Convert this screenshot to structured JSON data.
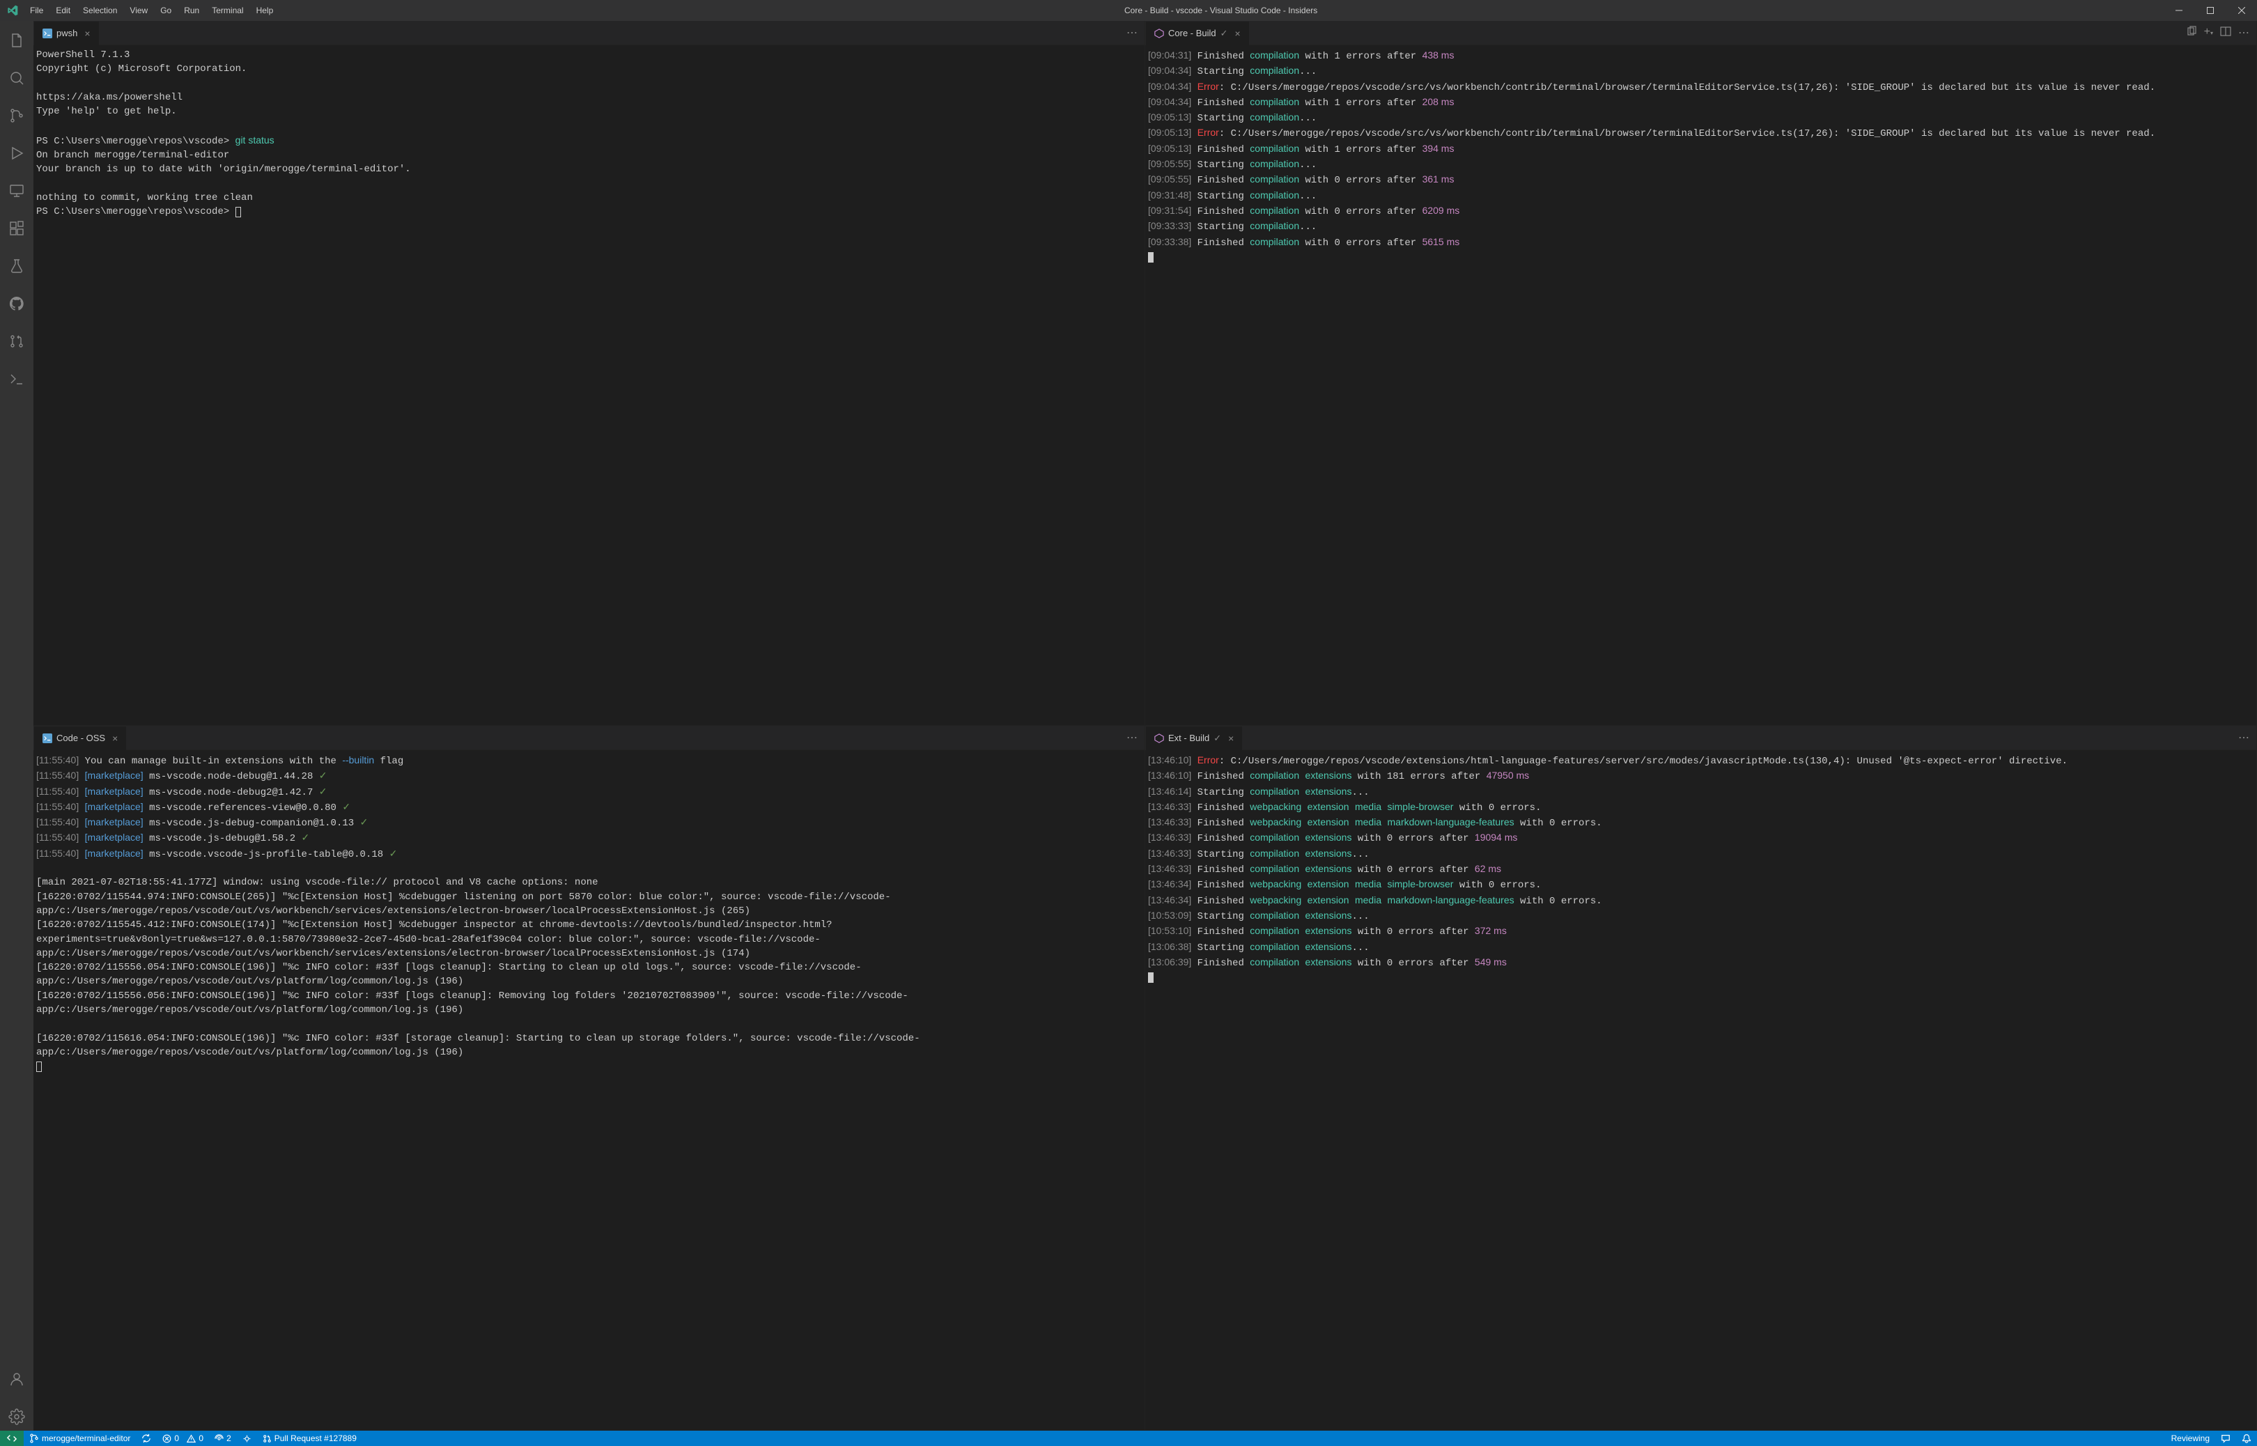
{
  "menubar": [
    "File",
    "Edit",
    "Selection",
    "View",
    "Go",
    "Run",
    "Terminal",
    "Help"
  ],
  "window_title": "Core - Build - vscode - Visual Studio Code - Insiders",
  "tabs": {
    "top_left": {
      "label": "pwsh"
    },
    "top_right": {
      "label": "Core - Build"
    },
    "bottom_left": {
      "label": "Code - OSS"
    },
    "bottom_right": {
      "label": "Ext - Build"
    }
  },
  "pwsh": {
    "l1": "PowerShell 7.1.3",
    "l2": "Copyright (c) Microsoft Corporation.",
    "l3": "https://aka.ms/powershell",
    "l4": "Type 'help' to get help.",
    "prompt1": "PS C:\\Users\\merogge\\repos\\vscode> ",
    "cmd1": "git status",
    "l5": "On branch merogge/terminal-editor",
    "l6": "Your branch is up to date with 'origin/merogge/terminal-editor'.",
    "l7": "nothing to commit, working tree clean",
    "prompt2": "PS C:\\Users\\merogge\\repos\\vscode> "
  },
  "core": [
    {
      "t": "09:04:31",
      "p": [
        "Finished ",
        "compilation",
        " with 1 errors after ",
        "438 ms"
      ]
    },
    {
      "t": "09:04:34",
      "p": [
        "Starting ",
        "compilation",
        "..."
      ]
    },
    {
      "t": "09:04:34",
      "err": "Error",
      "msg": ": C:/Users/merogge/repos/vscode/src/vs/workbench/contrib/terminal/browser/terminalEditorService.ts(17,26): 'SIDE_GROUP' is declared but its value is never read."
    },
    {
      "t": "09:04:34",
      "p": [
        "Finished ",
        "compilation",
        " with 1 errors after ",
        "208 ms"
      ]
    },
    {
      "t": "09:05:13",
      "p": [
        "Starting ",
        "compilation",
        "..."
      ]
    },
    {
      "t": "09:05:13",
      "err": "Error",
      "msg": ": C:/Users/merogge/repos/vscode/src/vs/workbench/contrib/terminal/browser/terminalEditorService.ts(17,26): 'SIDE_GROUP' is declared but its value is never read."
    },
    {
      "t": "09:05:13",
      "p": [
        "Finished ",
        "compilation",
        " with 1 errors after ",
        "394 ms"
      ]
    },
    {
      "t": "09:05:55",
      "p": [
        "Starting ",
        "compilation",
        "..."
      ]
    },
    {
      "t": "09:05:55",
      "p": [
        "Finished ",
        "compilation",
        " with 0 errors after ",
        "361 ms"
      ]
    },
    {
      "t": "09:31:48",
      "p": [
        "Starting ",
        "compilation",
        "..."
      ]
    },
    {
      "t": "09:31:54",
      "p": [
        "Finished ",
        "compilation",
        " with 0 errors after ",
        "6209 ms"
      ]
    },
    {
      "t": "09:33:33",
      "p": [
        "Starting ",
        "compilation",
        "..."
      ]
    },
    {
      "t": "09:33:38",
      "p": [
        "Finished ",
        "compilation",
        " with 0 errors after ",
        "5615 ms"
      ]
    }
  ],
  "oss_head": {
    "t": "11:55:40",
    "pre": "You can manage built-in extensions with the ",
    "opt": "--builtin",
    "post": " flag"
  },
  "oss_mp": [
    {
      "t": "11:55:40",
      "txt": "ms-vscode.node-debug@1.44.28"
    },
    {
      "t": "11:55:40",
      "txt": "ms-vscode.node-debug2@1.42.7"
    },
    {
      "t": "11:55:40",
      "txt": "ms-vscode.references-view@0.0.80"
    },
    {
      "t": "11:55:40",
      "txt": "ms-vscode.js-debug-companion@1.0.13"
    },
    {
      "t": "11:55:40",
      "txt": "ms-vscode.js-debug@1.58.2"
    },
    {
      "t": "11:55:40",
      "txt": "ms-vscode.vscode-js-profile-table@0.0.18"
    }
  ],
  "oss_body": "\n[main 2021-07-02T18:55:41.177Z] window: using vscode-file:// protocol and V8 cache options: none\n[16220:0702/115544.974:INFO:CONSOLE(265)] \"%c[Extension Host] %cdebugger listening on port 5870 color: blue color:\", source: vscode-file://vscode-app/c:/Users/merogge/repos/vscode/out/vs/workbench/services/extensions/electron-browser/localProcessExtensionHost.js (265)\n[16220:0702/115545.412:INFO:CONSOLE(174)] \"%c[Extension Host] %cdebugger inspector at chrome-devtools://devtools/bundled/inspector.html?experiments=true&v8only=true&ws=127.0.0.1:5870/73980e32-2ce7-45d0-bca1-28afe1f39c04 color: blue color:\", source: vscode-file://vscode-app/c:/Users/merogge/repos/vscode/out/vs/workbench/services/extensions/electron-browser/localProcessExtensionHost.js (174)\n[16220:0702/115556.054:INFO:CONSOLE(196)] \"%c INFO color: #33f [logs cleanup]: Starting to clean up old logs.\", source: vscode-file://vscode-app/c:/Users/merogge/repos/vscode/out/vs/platform/log/common/log.js (196)\n[16220:0702/115556.056:INFO:CONSOLE(196)] \"%c INFO color: #33f [logs cleanup]: Removing log folders '20210702T083909'\", source: vscode-file://vscode-app/c:/Users/merogge/repos/vscode/out/vs/platform/log/common/log.js (196)\n\n[16220:0702/115616.054:INFO:CONSOLE(196)] \"%c INFO color: #33f [storage cleanup]: Starting to clean up storage folders.\", source: vscode-file://vscode-app/c:/Users/merogge/repos/vscode/out/vs/platform/log/common/log.js (196)",
  "ext": [
    {
      "t": "13:46:10",
      "err": "Error",
      "msg": ": C:/Users/merogge/repos/vscode/extensions/html-language-features/server/src/modes/javascriptMode.ts(130,4): Unused '@ts-expect-error' directive."
    },
    {
      "t": "13:46:10",
      "p": [
        "Finished ",
        "compilation",
        " ",
        "extensions",
        " with 181 errors after ",
        "47950 ms"
      ]
    },
    {
      "t": "13:46:14",
      "p": [
        "Starting ",
        "compilation",
        " ",
        "extensions",
        "..."
      ]
    },
    {
      "t": "13:46:33",
      "p": [
        "Finished ",
        "webpacking",
        " ",
        "extension",
        " ",
        "media",
        " ",
        "simple-browser",
        " with 0 errors."
      ]
    },
    {
      "t": "13:46:33",
      "p": [
        "Finished ",
        "webpacking",
        " ",
        "extension",
        " ",
        "media",
        " ",
        "markdown-language-features",
        " with 0 errors."
      ]
    },
    {
      "t": "13:46:33",
      "p": [
        "Finished ",
        "compilation",
        " ",
        "extensions",
        " with 0 errors after ",
        "19094 ms"
      ]
    },
    {
      "t": "13:46:33",
      "p": [
        "Starting ",
        "compilation",
        " ",
        "extensions",
        "..."
      ]
    },
    {
      "t": "13:46:33",
      "p": [
        "Finished ",
        "compilation",
        " ",
        "extensions",
        " with 0 errors after ",
        "62 ms"
      ]
    },
    {
      "t": "13:46:34",
      "p": [
        "Finished ",
        "webpacking",
        " ",
        "extension",
        " ",
        "media",
        " ",
        "simple-browser",
        " with 0 errors."
      ]
    },
    {
      "t": "13:46:34",
      "p": [
        "Finished ",
        "webpacking",
        " ",
        "extension",
        " ",
        "media",
        " ",
        "markdown-language-features",
        " with 0 errors."
      ]
    },
    {
      "t": "10:53:09",
      "p": [
        "Starting ",
        "compilation",
        " ",
        "extensions",
        "..."
      ]
    },
    {
      "t": "10:53:10",
      "p": [
        "Finished ",
        "compilation",
        " ",
        "extensions",
        " with 0 errors after ",
        "372 ms"
      ]
    },
    {
      "t": "13:06:38",
      "p": [
        "Starting ",
        "compilation",
        " ",
        "extensions",
        "..."
      ]
    },
    {
      "t": "13:06:39",
      "p": [
        "Finished ",
        "compilation",
        " ",
        "extensions",
        " with 0 errors after ",
        "549 ms"
      ]
    }
  ],
  "status": {
    "branch": "merogge/terminal-editor",
    "errors": "0",
    "warnings": "0",
    "ports": "2",
    "pull": "Pull Request #127889",
    "review": "Reviewing"
  }
}
